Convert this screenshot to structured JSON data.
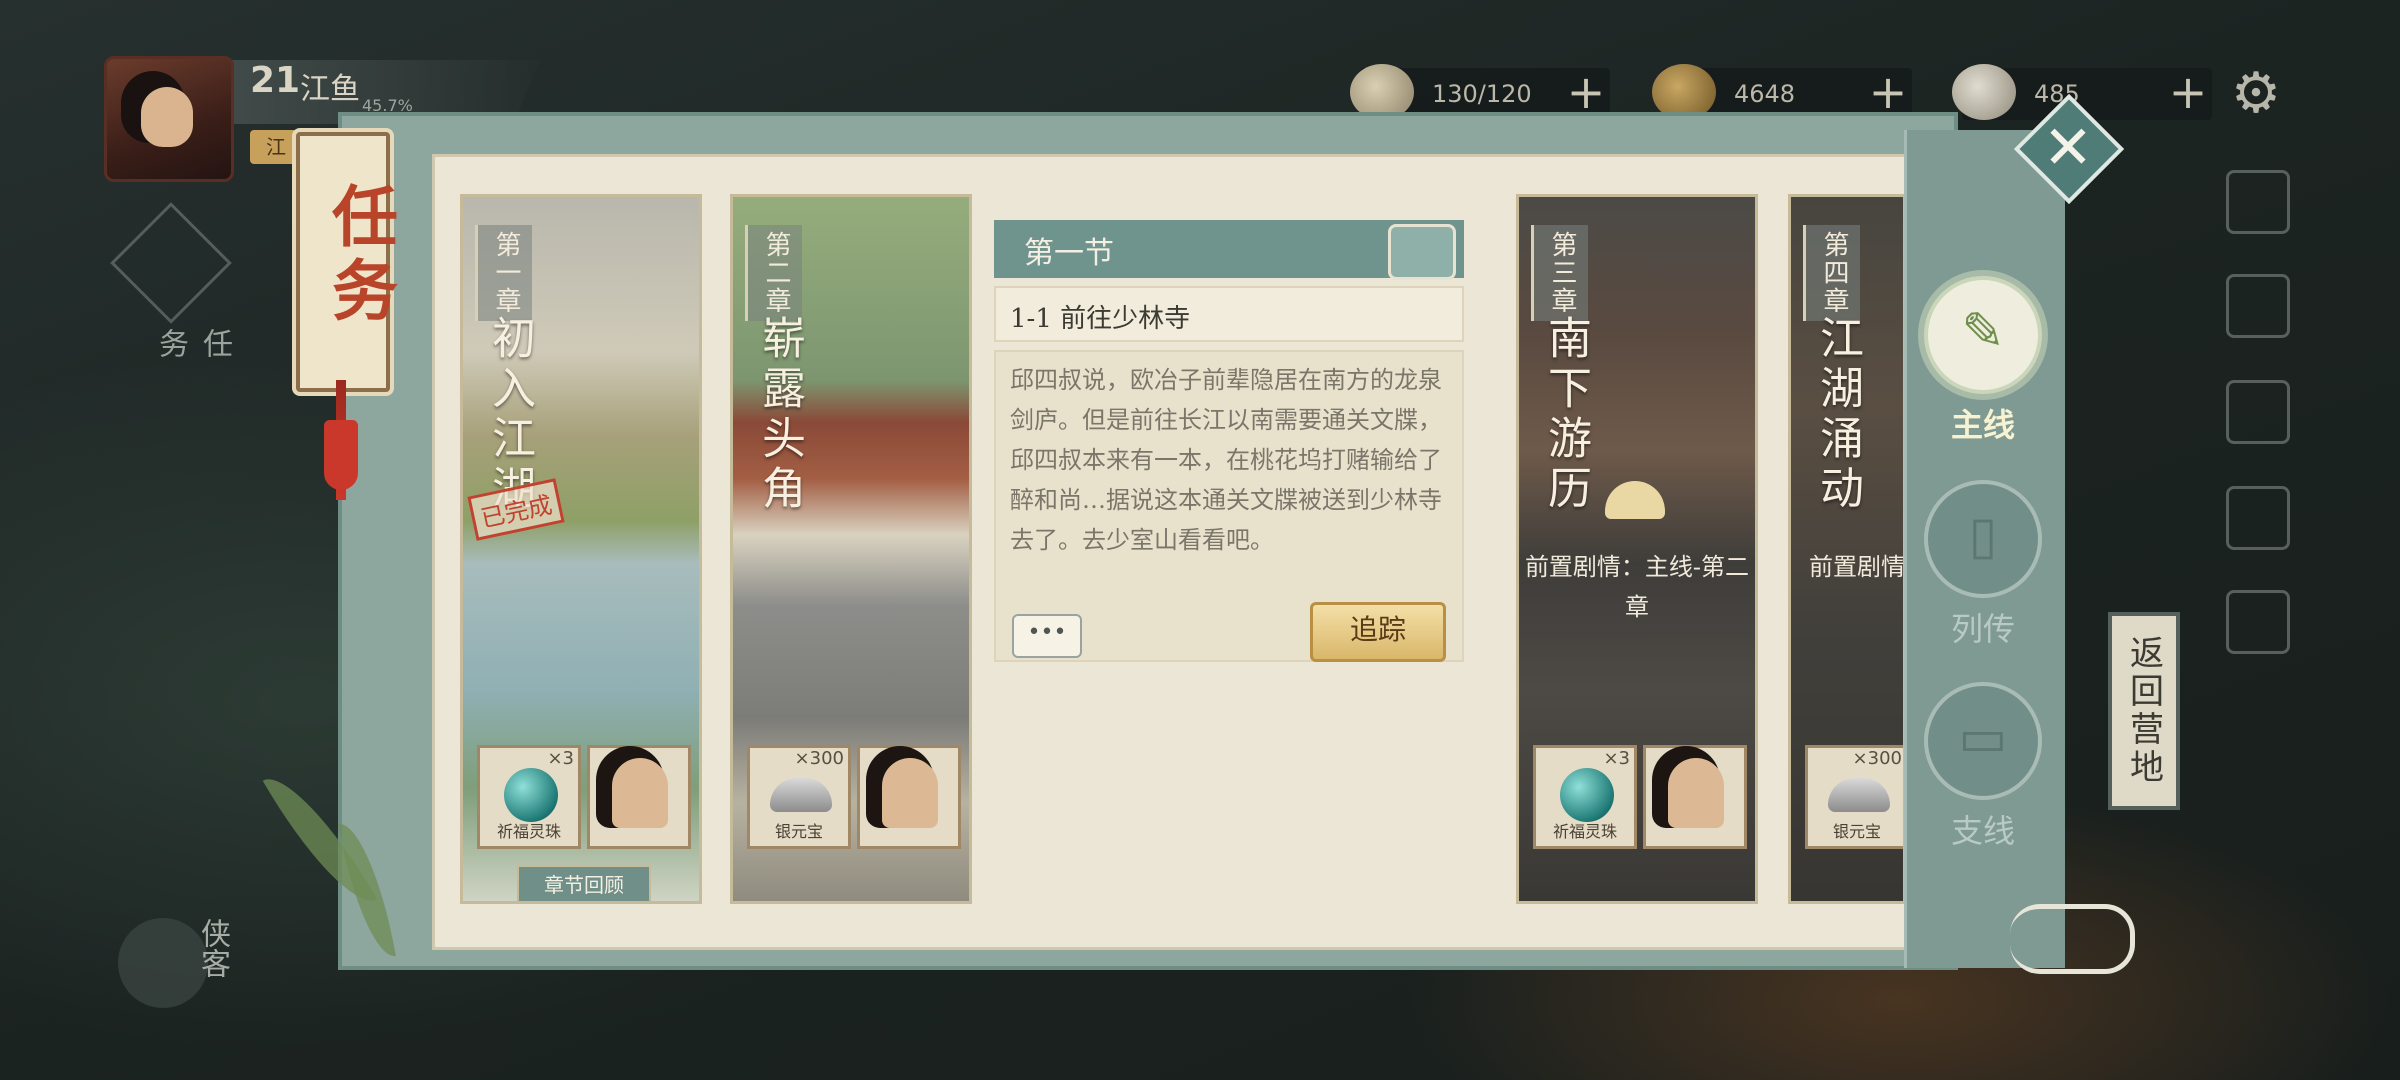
{
  "player": {
    "level": "21",
    "name": "江鱼",
    "exp_pct": "45.7%",
    "tag": "江"
  },
  "resources": [
    {
      "icon": "stamina-icon",
      "value": "130/120"
    },
    {
      "icon": "copper-coins-icon",
      "value": "4648"
    },
    {
      "icon": "silver-ingot-icon",
      "value": "485"
    }
  ],
  "left_nav": {
    "quest_label": "任务",
    "hero_label": "侠客"
  },
  "right_side": {
    "return_camp": "返回营地"
  },
  "panel": {
    "title": "任务",
    "chapters": [
      {
        "index": "第一章",
        "title": "初入江湖",
        "status": "已完成",
        "rewards": [
          {
            "name": "祈福灵珠",
            "count": "×3"
          },
          {
            "name": "",
            "count": ""
          }
        ],
        "review_button": "章节回顾"
      },
      {
        "index": "第二章",
        "title": "崭露头角",
        "rewards": [
          {
            "name": "银元宝",
            "count": "×300"
          },
          {
            "name": "",
            "count": ""
          }
        ]
      },
      {
        "index": "第三章",
        "title": "南下游历",
        "prereq": "前置剧情：主线-第二章",
        "rewards": [
          {
            "name": "祈福灵珠",
            "count": "×3"
          },
          {
            "name": "",
            "count": ""
          }
        ]
      },
      {
        "index": "第四章",
        "title": "江湖涌动",
        "prereq": "前置剧情：第三章、雄",
        "rewards": [
          {
            "name": "银元宝",
            "count": "×300"
          }
        ]
      }
    ],
    "detail": {
      "section": "第一节",
      "quest_name": "1-1 前往少林寺",
      "description": "邱四叔说，欧冶子前辈隐居在南方的龙泉剑庐。但是前往长江以南需要通关文牒，邱四叔本来有一本，在桃花坞打赌输给了醉和尚…据说这本通关文牒被送到少林寺去了。去少室山看看吧。",
      "chat_button": "•••",
      "track_button": "追踪"
    },
    "tabs": [
      {
        "label": "主线",
        "active": true
      },
      {
        "label": "列传",
        "active": false
      },
      {
        "label": "支线",
        "active": false
      }
    ]
  },
  "colors": {
    "accent_teal": "#6f938d",
    "stamp_red": "#c0432f",
    "gold_button": "#d9b76a"
  }
}
